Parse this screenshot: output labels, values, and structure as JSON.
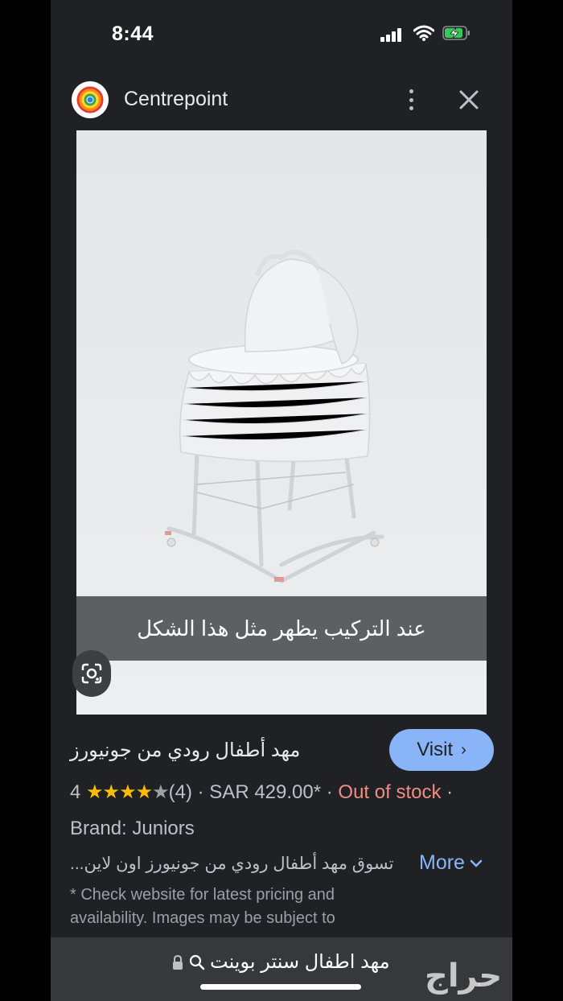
{
  "status": {
    "time": "8:44"
  },
  "header": {
    "site_name": "Centrepoint"
  },
  "image": {
    "caption": "عند التركيب يظهر مثل هذا الشكل"
  },
  "product": {
    "title": "مهد أطفال رودي من جونيورز",
    "visit_label": "Visit",
    "rating": "4",
    "rating_stars": 4,
    "review_count": "(4)",
    "separator": "·",
    "price": "SAR 429.00*",
    "stock": "Out of stock",
    "brand": "Brand: Juniors",
    "description": "تسوق مهد أطفال رودي من جونيورز اون لاين...",
    "more_label": "More",
    "note": "* Check website for latest pricing and availability. Images may be subject to"
  },
  "urlbar": {
    "text": "مهد اطفال سنتر بوينت"
  },
  "watermark": {
    "text": "حراج"
  },
  "colors": {
    "accent": "#8ab4f8",
    "star": "#fbbc04",
    "out_of_stock": "#f28b82"
  }
}
